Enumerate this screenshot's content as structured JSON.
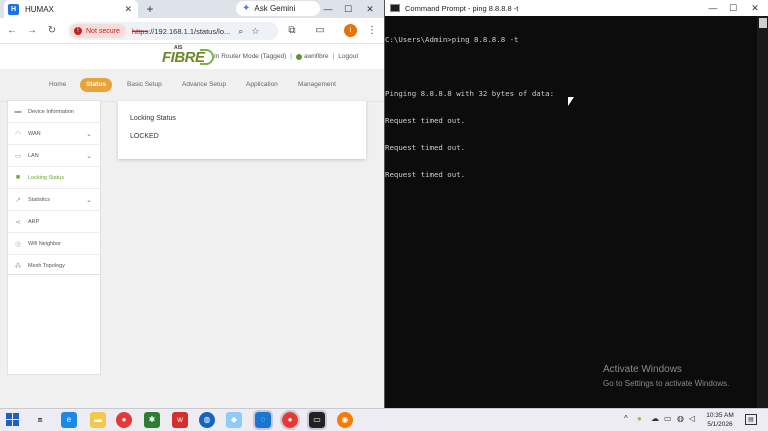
{
  "browser": {
    "tab_title": "HUMAX",
    "tab_favicon": "H",
    "gemini_label": "Ask Gemini",
    "url_badge": "Not secure",
    "url_scheme": "https",
    "url_rest": "://192.168.1.1/status/lo...",
    "profile_initial": "i"
  },
  "site": {
    "logo_top": "AIS",
    "logo_text": "FIBRE",
    "mode_text": "In Router Mode (Tagged)",
    "username": "awnfibre",
    "logout": "Logout",
    "nav": [
      "Home",
      "Status",
      "Basic Setup",
      "Advance Setup",
      "Application",
      "Management"
    ],
    "sidebar": [
      {
        "label": "Device Information",
        "icon": "info-icon",
        "chevron": false
      },
      {
        "label": "WAN",
        "icon": "wifi-icon",
        "chevron": true
      },
      {
        "label": "LAN",
        "icon": "lan-icon",
        "chevron": true
      },
      {
        "label": "Locking Status",
        "icon": "lock-icon",
        "chevron": false
      },
      {
        "label": "Statistics",
        "icon": "stats-icon",
        "chevron": true
      },
      {
        "label": "ARP",
        "icon": "share-icon",
        "chevron": false
      },
      {
        "label": "Wifi Neighbor",
        "icon": "wifi-neighbor-icon",
        "chevron": false
      },
      {
        "label": "Mesh Topology",
        "icon": "mesh-icon",
        "chevron": false
      }
    ],
    "card_title": "Locking Status",
    "card_value": "LOCKED",
    "accent": "#6aa534",
    "status_tab_color": "#e8a33a"
  },
  "cmd": {
    "title": "Command Prompt - ping  8.8.8.8 -t",
    "lines": [
      "C:\\Users\\Admin>ping 8.8.8.8 -t",
      "",
      "Pinging 8.8.8.8 with 32 bytes of data:",
      "Request timed out.",
      "Request timed out.",
      "Request timed out."
    ],
    "watermark_title": "Activate Windows",
    "watermark_sub": "Go to Settings to activate Windows."
  },
  "taskbar": {
    "time": "10:35 AM",
    "date": "5/1/2026"
  }
}
